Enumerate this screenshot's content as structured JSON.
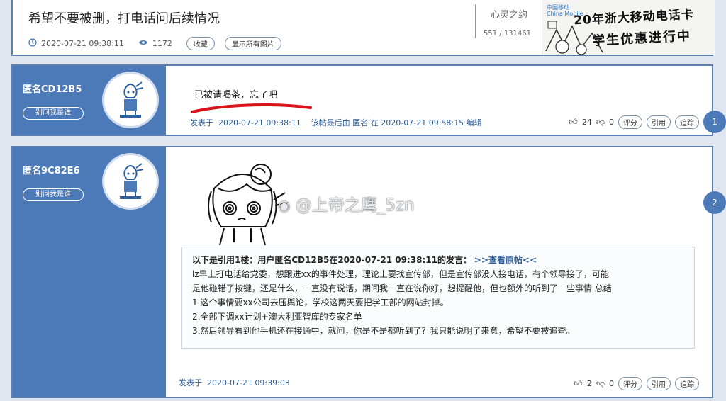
{
  "thread": {
    "title": "希望不要被删，打电话问后续情况",
    "time": "2020-07-21 09:38:11",
    "views": "1172",
    "favorite_label": "收藏",
    "show_images_label": "显示所有图片",
    "author": "心灵之约",
    "counts": "551 / 131461"
  },
  "ad": {
    "brand": "中国移动\nChina Mobile",
    "line1": "20年浙大移动电话卡",
    "line2": "学生优惠进行中"
  },
  "posts": [
    {
      "floor": "1",
      "user": "匿名CD12B5",
      "who_label": "别问我是谁",
      "body": "已被请喝茶，忘了吧",
      "footer": "发表于  2020-07-21 09:38:11    该帖最后由 匿名 在 2020-07-21 09:58:15 编辑",
      "likes": "24",
      "dislikes": "0",
      "rate_label": "评分",
      "quote_label": "引用",
      "trace_label": "追踪"
    },
    {
      "floor": "2",
      "user": "匿名9C82E6",
      "who_label": "别问我是谁",
      "watermark": "@上帝之鹰_5zn",
      "quote_header": "以下是引用1楼：用户匿名CD12B5在2020-07-21 09:38:11的发言：",
      "quote_link": ">>查看原帖<<",
      "quote_lines": [
        "lz早上打电话给党委，想跟进xx的事件处理，理论上要找宣传部，但是宣传部没人接电话，有个领导接了，可能",
        "是他碰错了按键，还是什么，一直没有说话，期间我一直在说你好，想提醒他，但也额外的听到了一些事情 总结",
        "1.这个事情要xx公司去压舆论，学校这两天要把学工部的网站封掉。",
        "2.全部下调xx计划+澳大利亚智库的专家名单",
        "3.然后领导看到他手机还在接通中，就问，你是不是都听到了？我只能说明了来意，希望不要被追查。"
      ],
      "footer": "发表于  2020-07-21 09:39:03",
      "likes": "2",
      "dislikes": "0",
      "rate_label": "评分",
      "quote_label": "引用",
      "trace_label": "追踪"
    }
  ],
  "colors": {
    "accent": "#4c79b8",
    "annotation": "#d9121b",
    "link": "#2f5f98"
  },
  "icons": [
    "clock-icon",
    "eye-icon",
    "thumbs-up-icon",
    "thumbs-down-icon",
    "weibo-icon",
    "avatar-icon"
  ]
}
